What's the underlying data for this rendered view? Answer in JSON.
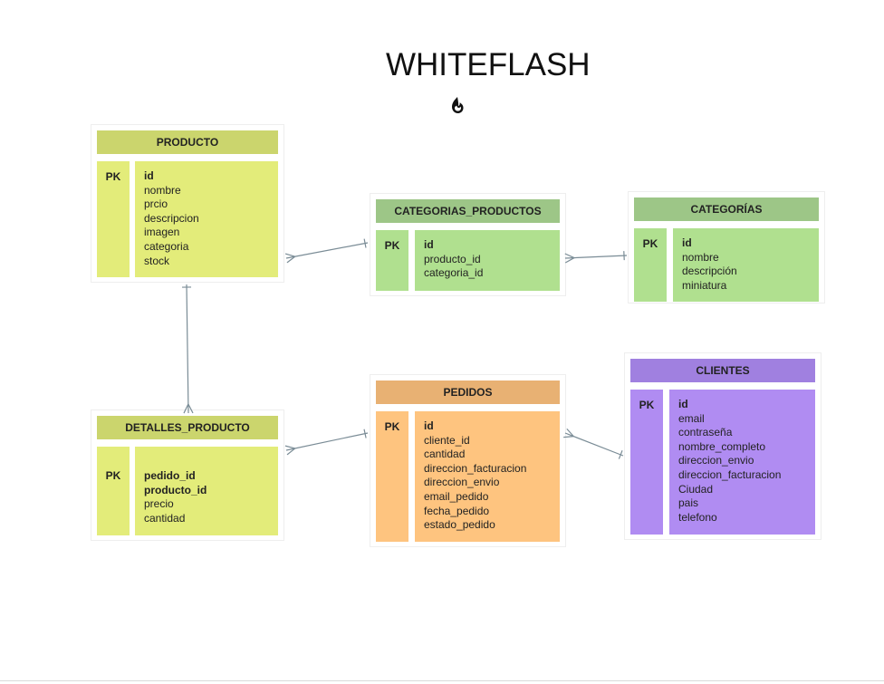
{
  "title": "WHITEFLASH",
  "colors": {
    "producto_header": "#cbd56d",
    "producto_body": "#e3ec7a",
    "categorias_header": "#9dc687",
    "categorias_body": "#b0e08f",
    "pedidos_header": "#e8b173",
    "pedidos_body": "#fec47f",
    "clientes_header": "#a080e0",
    "clientes_body": "#b08cf2",
    "connector": "#7a8c96"
  },
  "tables": {
    "producto": {
      "name": "PRODUCTO",
      "pk": "PK",
      "fields": [
        {
          "text": "id",
          "bold": true
        },
        {
          "text": "nombre",
          "bold": false
        },
        {
          "text": "prcio",
          "bold": false
        },
        {
          "text": "descripcion",
          "bold": false
        },
        {
          "text": "imagen",
          "bold": false
        },
        {
          "text": "categoria",
          "bold": false
        },
        {
          "text": "stock",
          "bold": false
        }
      ]
    },
    "categorias_productos": {
      "name": "CATEGORIAS_PRODUCTOS",
      "pk": "PK",
      "fields": [
        {
          "text": "id",
          "bold": true
        },
        {
          "text": "producto_id",
          "bold": false
        },
        {
          "text": "categoria_id",
          "bold": false
        }
      ]
    },
    "categorias": {
      "name": "CATEGORÍAS",
      "pk": "PK",
      "fields": [
        {
          "text": "id",
          "bold": true
        },
        {
          "text": "nombre",
          "bold": false
        },
        {
          "text": "descripción",
          "bold": false
        },
        {
          "text": "miniatura",
          "bold": false
        }
      ]
    },
    "detalles_producto": {
      "name": "DETALLES_PRODUCTO",
      "pk": "PK",
      "fields": [
        {
          "text": "pedido_id",
          "bold": true
        },
        {
          "text": "producto_id",
          "bold": true
        },
        {
          "text": "precio",
          "bold": false
        },
        {
          "text": "cantidad",
          "bold": false
        }
      ]
    },
    "pedidos": {
      "name": "PEDIDOS",
      "pk": "PK",
      "fields": [
        {
          "text": "id",
          "bold": true
        },
        {
          "text": "cliente_id",
          "bold": false
        },
        {
          "text": "cantidad",
          "bold": false
        },
        {
          "text": "direccion_facturacion",
          "bold": false
        },
        {
          "text": "direccion_envio",
          "bold": false
        },
        {
          "text": "email_pedido",
          "bold": false
        },
        {
          "text": "fecha_pedido",
          "bold": false
        },
        {
          "text": "estado_pedido",
          "bold": false
        }
      ]
    },
    "clientes": {
      "name": "CLIENTES",
      "pk": "PK",
      "fields": [
        {
          "text": "id",
          "bold": true
        },
        {
          "text": "email",
          "bold": false
        },
        {
          "text": "contraseña",
          "bold": false
        },
        {
          "text": "nombre_completo",
          "bold": false
        },
        {
          "text": "direccion_envio",
          "bold": false
        },
        {
          "text": "direccion_facturacion",
          "bold": false
        },
        {
          "text": "Ciudad",
          "bold": false
        },
        {
          "text": "pais",
          "bold": false
        },
        {
          "text": "telefono",
          "bold": false
        }
      ]
    }
  },
  "relationships": [
    {
      "from": "producto",
      "to": "categorias_productos",
      "from_end": "many",
      "to_end": "one"
    },
    {
      "from": "categorias_productos",
      "to": "categorias",
      "from_end": "many",
      "to_end": "one"
    },
    {
      "from": "producto",
      "to": "detalles_producto",
      "from_end": "one",
      "to_end": "many"
    },
    {
      "from": "detalles_producto",
      "to": "pedidos",
      "from_end": "many",
      "to_end": "one"
    },
    {
      "from": "pedidos",
      "to": "clientes",
      "from_end": "many",
      "to_end": "one"
    }
  ],
  "logo_icon": "flame-icon"
}
